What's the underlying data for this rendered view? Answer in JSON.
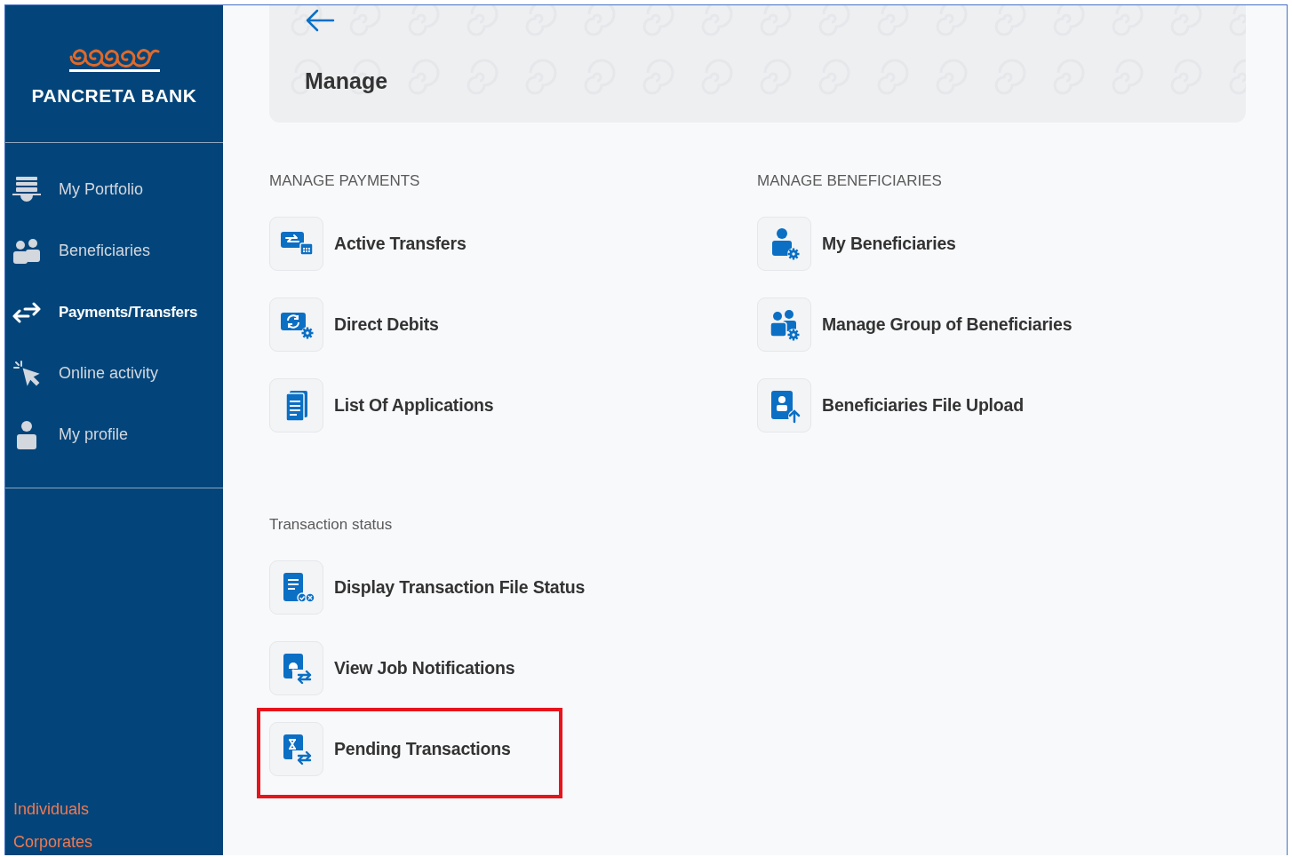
{
  "sidebar": {
    "brand": "PANCRETA BANK",
    "items": [
      {
        "label": "My Portfolio",
        "selected": false
      },
      {
        "label": "Beneficiaries",
        "selected": false
      },
      {
        "label": "Payments/Transfers",
        "selected": true
      },
      {
        "label": "Online activity",
        "selected": false
      },
      {
        "label": "My profile",
        "selected": false
      }
    ],
    "footer_links": [
      "Individuals",
      "Corporates"
    ]
  },
  "header": {
    "title": "Manage"
  },
  "sections": [
    {
      "title": "MANAGE PAYMENTS",
      "items": [
        {
          "label": "Active Transfers",
          "highlighted": false
        },
        {
          "label": "Direct Debits",
          "highlighted": false
        },
        {
          "label": "List Of Applications",
          "highlighted": false
        }
      ]
    },
    {
      "title": "MANAGE BENEFICIARIES",
      "items": [
        {
          "label": "My Beneficiaries",
          "highlighted": false
        },
        {
          "label": "Manage Group of Beneficiaries",
          "highlighted": false
        },
        {
          "label": "Beneficiaries File Upload",
          "highlighted": false
        }
      ]
    },
    {
      "title": "Transaction status",
      "items": [
        {
          "label": "Display Transaction File Status",
          "highlighted": false
        },
        {
          "label": "View Job Notifications",
          "highlighted": false
        },
        {
          "label": "Pending Transactions",
          "highlighted": true
        }
      ]
    }
  ]
}
